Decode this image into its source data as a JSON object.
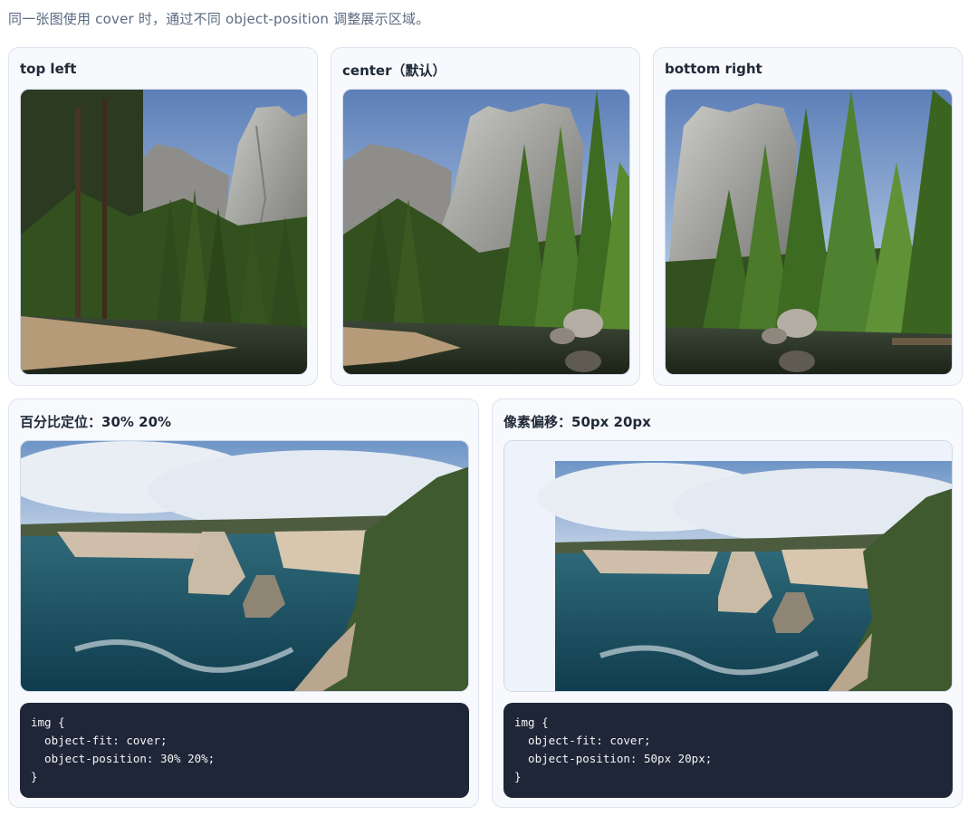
{
  "intro": "同一张图使用 cover 时，通过不同 object-position 调整展示区域。",
  "cards": {
    "top_left": {
      "title": "top left"
    },
    "center": {
      "title": "center（默认）"
    },
    "bottom_right": {
      "title": "bottom right"
    },
    "percent": {
      "title": "百分比定位：30% 20%",
      "code": "img {\n  object-fit: cover;\n  object-position: 30% 20%;\n}"
    },
    "pixel": {
      "title": "像素偏移：50px 20px",
      "code": "img {\n  object-fit: cover;\n  object-position: 50px 20px;\n}"
    }
  },
  "colors": {
    "card_bg": "#f7f9fc",
    "card_border": "#dde4ef",
    "code_bg": "#1f2638",
    "intro_text": "#5b6b82",
    "frame_empty_bg": "#eef3fb"
  },
  "images": {
    "mountain": "mountain-forest-lake-photo",
    "coast": "coastal-cliffs-ocean-photo"
  }
}
